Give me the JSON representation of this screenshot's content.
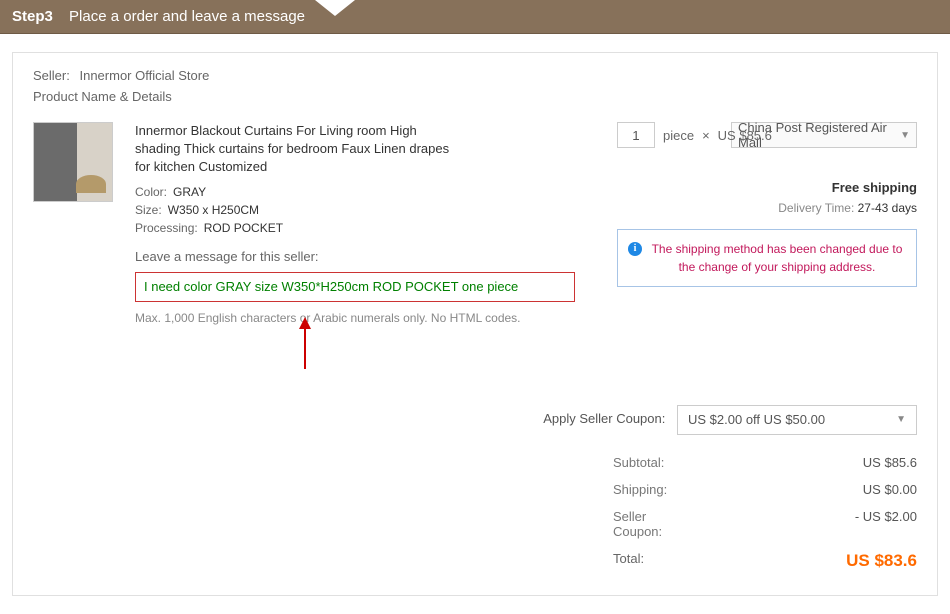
{
  "header": {
    "step": "Step3",
    "title": "Place a order and leave a message"
  },
  "seller": {
    "label": "Seller:",
    "name": "Innermor Official Store",
    "details_label": "Product Name & Details"
  },
  "product": {
    "title": "Innermor Blackout Curtains For Living room High shading Thick curtains for bedroom Faux Linen drapes for kitchen Customized",
    "color_label": "Color:",
    "color_value": "GRAY",
    "size_label": "Size:",
    "size_value": "W350 x H250CM",
    "processing_label": "Processing:",
    "processing_value": "ROD POCKET"
  },
  "message": {
    "label": "Leave a message for this seller:",
    "value": "I need color GRAY size W350*H250cm ROD POCKET one piece",
    "note": "Max. 1,000 English characters or Arabic numerals only. No HTML codes."
  },
  "qty": {
    "value": "1",
    "unit": "piece",
    "times": "×",
    "price": "US $85.6"
  },
  "shipping": {
    "method": "China Post Registered Air Mail",
    "free": "Free shipping",
    "delivery_label": "Delivery Time:",
    "delivery_value": "27-43 days"
  },
  "info_box": "The shipping method has been changed due to the change of your shipping address.",
  "coupon": {
    "label": "Apply Seller Coupon:",
    "value": "US $2.00 off US $50.00"
  },
  "totals": {
    "subtotal_label": "Subtotal:",
    "subtotal_value": "US $85.6",
    "shipping_label": "Shipping:",
    "shipping_value": "US $0.00",
    "coupon_label": "Seller Coupon:",
    "coupon_value": "- US $2.00",
    "total_label": "Total:",
    "total_value": "US $83.6"
  }
}
